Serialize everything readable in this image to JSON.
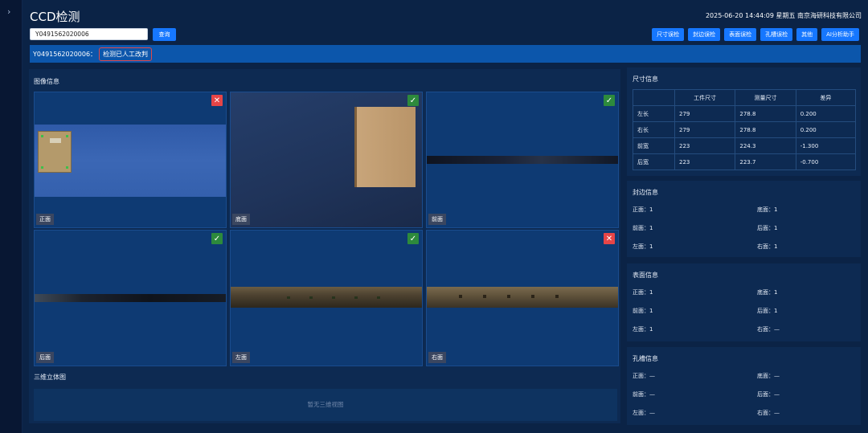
{
  "app": {
    "title": "CCD检测",
    "datetime": "2025-06-20 14:44:09 星期五 南京海研科技有限公司"
  },
  "search": {
    "value": "Y0491562020006",
    "query_label": "查询"
  },
  "toolbar": [
    "尺寸误检",
    "封边误检",
    "表面误检",
    "孔槽误检",
    "其他",
    "AI分析助手"
  ],
  "status": {
    "serial": "Y0491562020006：",
    "tag": "检测已人工改判"
  },
  "images": {
    "title": "图像信息",
    "cells": [
      {
        "label": "正面",
        "result": "fail"
      },
      {
        "label": "底面",
        "result": "pass"
      },
      {
        "label": "前面",
        "result": "pass"
      },
      {
        "label": "后面",
        "result": "pass"
      },
      {
        "label": "左面",
        "result": "pass"
      },
      {
        "label": "右面",
        "result": "fail"
      }
    ],
    "icons": {
      "pass": "✓",
      "fail": "✕"
    }
  },
  "viewer3d": {
    "title": "三维立体图",
    "empty": "暂无三维视图"
  },
  "size": {
    "title": "尺寸信息",
    "headers": [
      "",
      "工件尺寸",
      "测量尺寸",
      "差异"
    ],
    "rows": [
      [
        "左长",
        "279",
        "278.8",
        "0.200"
      ],
      [
        "右长",
        "279",
        "278.8",
        "0.200"
      ],
      [
        "前宽",
        "223",
        "224.3",
        "-1.300"
      ],
      [
        "后宽",
        "223",
        "223.7",
        "-0.700"
      ]
    ]
  },
  "edge": {
    "title": "封边信息",
    "items": [
      [
        "正面：1",
        "底面：1"
      ],
      [
        "前面：1",
        "后面：1"
      ],
      [
        "左面：1",
        "右面：1"
      ]
    ]
  },
  "surface": {
    "title": "表面信息",
    "items": [
      [
        "正面：1",
        "底面：1"
      ],
      [
        "前面：1",
        "后面：1"
      ],
      [
        "左面：1",
        "右面：—"
      ]
    ]
  },
  "hole": {
    "title": "孔槽信息",
    "items": [
      [
        "正面：—",
        "底面：—"
      ],
      [
        "前面：—",
        "后面：—"
      ],
      [
        "左面：—",
        "右面：—"
      ]
    ]
  },
  "colors": {
    "accent": "#1677ff",
    "pass": "#2d8a3c",
    "fail": "#e64547"
  }
}
